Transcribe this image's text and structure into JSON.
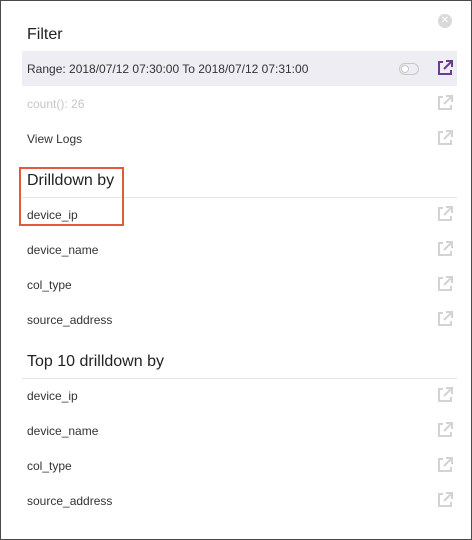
{
  "filter": {
    "title": "Filter",
    "range_label": "Range: 2018/07/12 07:30:00 To 2018/07/12 07:31:00",
    "count_label": "count(): 26",
    "view_logs_label": "View Logs"
  },
  "drilldown": {
    "title": "Drilldown by",
    "items": [
      "device_ip",
      "device_name",
      "col_type",
      "source_address"
    ]
  },
  "top10": {
    "title": "Top 10 drilldown by",
    "items": [
      "device_ip",
      "device_name",
      "col_type",
      "source_address"
    ]
  },
  "colors": {
    "accent": "#6c3b8f",
    "icon_muted": "#d3d3d3",
    "range_bg": "#eeedf3",
    "highlight": "#e05a3b"
  },
  "icons": {
    "close": "close-icon",
    "external": "external-link-icon",
    "toggle": "toggle-icon"
  }
}
